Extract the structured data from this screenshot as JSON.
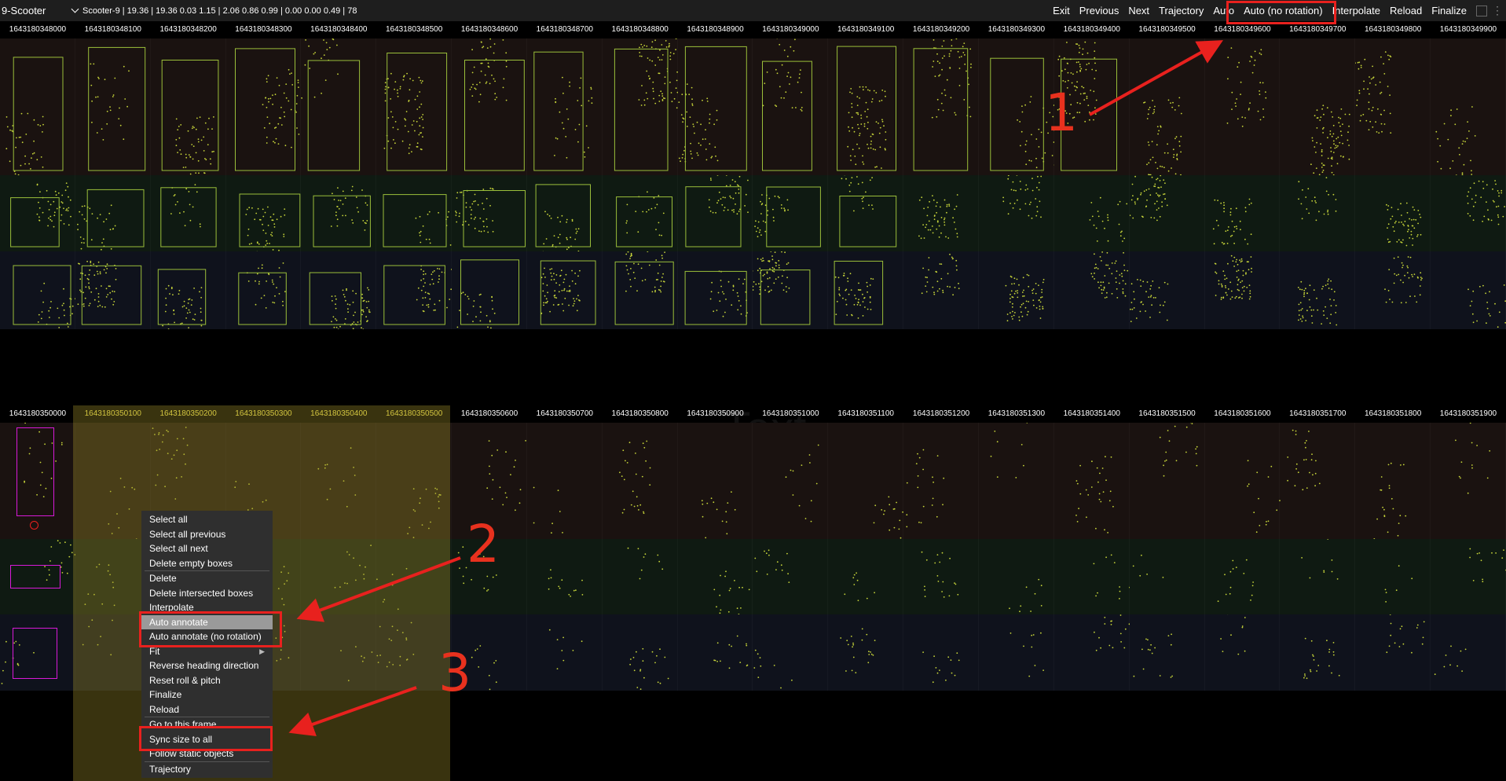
{
  "toolbar": {
    "object_id": "9-Scooter",
    "selector": "Scooter-9 | 19.36 | 19.36 0.03 1.15 | 2.06 0.86 0.99 | 0.00 0.00 0.49 | 78",
    "buttons": [
      "Exit",
      "Previous",
      "Next",
      "Trajectory",
      "Auto",
      "Auto (no rotation)",
      "Interpolate",
      "Reload",
      "Finalize"
    ]
  },
  "top_panel": {
    "timestamps": [
      "1643180348000",
      "1643180348100",
      "1643180348200",
      "1643180348300",
      "1643180348400",
      "1643180348500",
      "1643180348600",
      "1643180348700",
      "1643180348800",
      "1643180348900",
      "1643180349000",
      "1643180349100",
      "1643180349200",
      "1643180349300",
      "1643180349400",
      "1643180349500",
      "1643180349600",
      "1643180349700",
      "1643180349800",
      "1643180349900"
    ]
  },
  "bottom_panel": {
    "timestamps": [
      "1643180350000",
      "1643180350100",
      "1643180350200",
      "1643180350300",
      "1643180350400",
      "1643180350500",
      "1643180350600",
      "1643180350700",
      "1643180350800",
      "1643180350900",
      "1643180351000",
      "1643180351100",
      "1643180351200",
      "1643180351300",
      "1643180351400",
      "1643180351500",
      "1643180351600",
      "1643180351700",
      "1643180351800",
      "1643180351900"
    ],
    "highlighted": [
      1,
      2,
      3,
      4,
      5
    ]
  },
  "ghost_text": "Text",
  "context_menu": {
    "groups": [
      [
        "Select all",
        "Select all previous",
        "Select all next",
        "Delete empty boxes"
      ],
      [
        "Delete",
        "Delete intersected boxes",
        "Interpolate",
        "Auto annotate",
        "Auto annotate (no rotation)",
        "Fit",
        "Reverse heading direction",
        "Reset roll & pitch",
        "Finalize",
        "Reload"
      ],
      [
        "Go to this frame",
        "Sync size to all",
        "Follow static objects"
      ],
      [
        "Trajectory"
      ]
    ],
    "active": "Auto annotate"
  },
  "annotations": {
    "labels": [
      "1",
      "2",
      "3"
    ],
    "color": "#e8211e"
  },
  "colors": {
    "band_top": "#1a1210",
    "band_mid": "#0f1a12",
    "band_bot": "#0f121c",
    "points": "#c8d63a",
    "selection_box": "#d81ad8"
  }
}
